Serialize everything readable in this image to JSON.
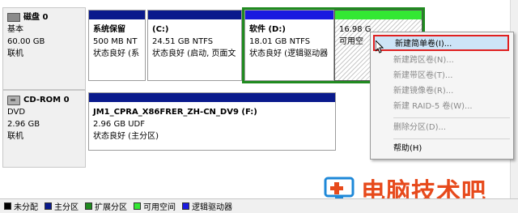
{
  "disks": [
    {
      "name": "磁盘 0",
      "type": "基本",
      "size": "60.00 GB",
      "status": "联机",
      "partitions": [
        {
          "title": "系统保留",
          "size": "500 MB NT",
          "status": "状态良好 (系",
          "bar_color": "#0a1a8c"
        },
        {
          "title": "(C:)",
          "size": "24.51 GB NTFS",
          "status": "状态良好 (启动, 页面文",
          "bar_color": "#0a1a8c"
        },
        {
          "title": "软件 (D:)",
          "size": "18.01 GB NTFS",
          "status": "状态良好 (逻辑驱动器",
          "bar_color": "#1a1ae0"
        },
        {
          "title": "",
          "size": "16.98 G",
          "status": "可用空",
          "bar_color": "#33e833"
        }
      ]
    },
    {
      "name": "CD-ROM 0",
      "type": "DVD",
      "size": "2.96 GB",
      "status": "联机",
      "partitions": [
        {
          "title": "JM1_CPRA_X86FRER_ZH-CN_DV9  (F:)",
          "size": "2.96 GB UDF",
          "status": "状态良好 (主分区)",
          "bar_color": "#0a1a8c"
        }
      ]
    }
  ],
  "context_menu": {
    "items": [
      {
        "label": "新建简单卷(I)...",
        "enabled": true,
        "highlighted": true
      },
      {
        "label": "新建跨区卷(N)...",
        "enabled": false
      },
      {
        "label": "新建带区卷(T)...",
        "enabled": false
      },
      {
        "label": "新建镜像卷(R)...",
        "enabled": false
      },
      {
        "label": "新建 RAID-5 卷(W)...",
        "enabled": false
      },
      {
        "label": "删除分区(D)...",
        "enabled": false
      },
      {
        "label": "帮助(H)",
        "enabled": true
      }
    ]
  },
  "legend": [
    {
      "label": "未分配",
      "color": "#000000"
    },
    {
      "label": "主分区",
      "color": "#0a1a8c"
    },
    {
      "label": "扩展分区",
      "color": "#1f8a1f"
    },
    {
      "label": "可用空间",
      "color": "#33e833"
    },
    {
      "label": "逻辑驱动器",
      "color": "#1a1ae0"
    }
  ],
  "watermark": {
    "text": "电脑技术吧"
  }
}
